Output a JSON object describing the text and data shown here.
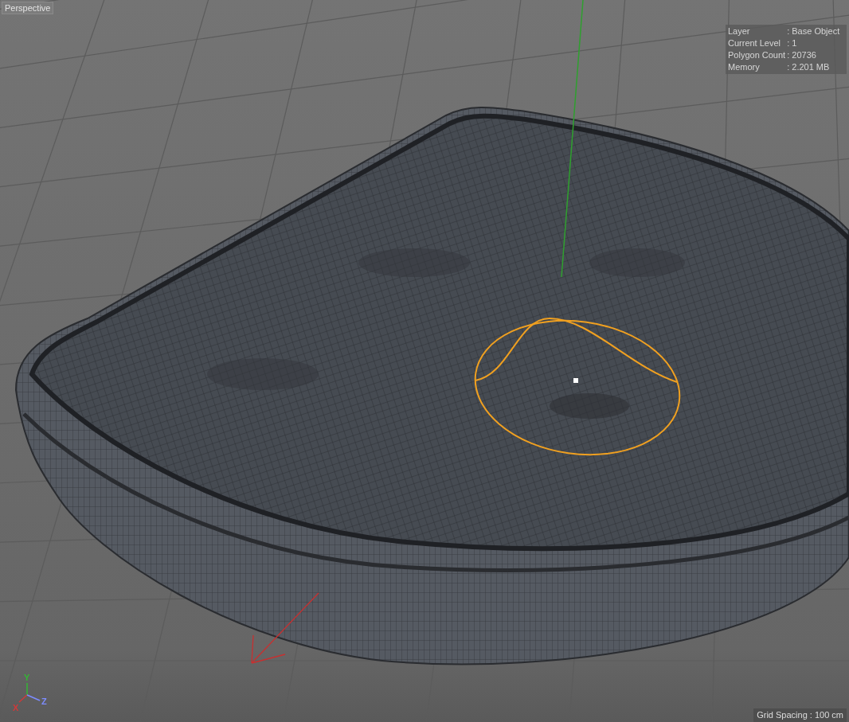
{
  "viewport": {
    "title": "Perspective"
  },
  "info_panel": [
    {
      "label": "Layer",
      "value": ": Base Object"
    },
    {
      "label": "Current Level",
      "value": ": 1"
    },
    {
      "label": "Polygon Count",
      "value": ": 20736"
    },
    {
      "label": "Memory",
      "value": ": 2.201 MB"
    }
  ],
  "axes": [
    {
      "label": "Y",
      "color": "#34b534"
    },
    {
      "label": "X",
      "color": "#d03a3a"
    },
    {
      "label": "Z",
      "color": "#7d8cff"
    }
  ],
  "status": {
    "grid_spacing": "Grid Spacing : 100 cm"
  }
}
